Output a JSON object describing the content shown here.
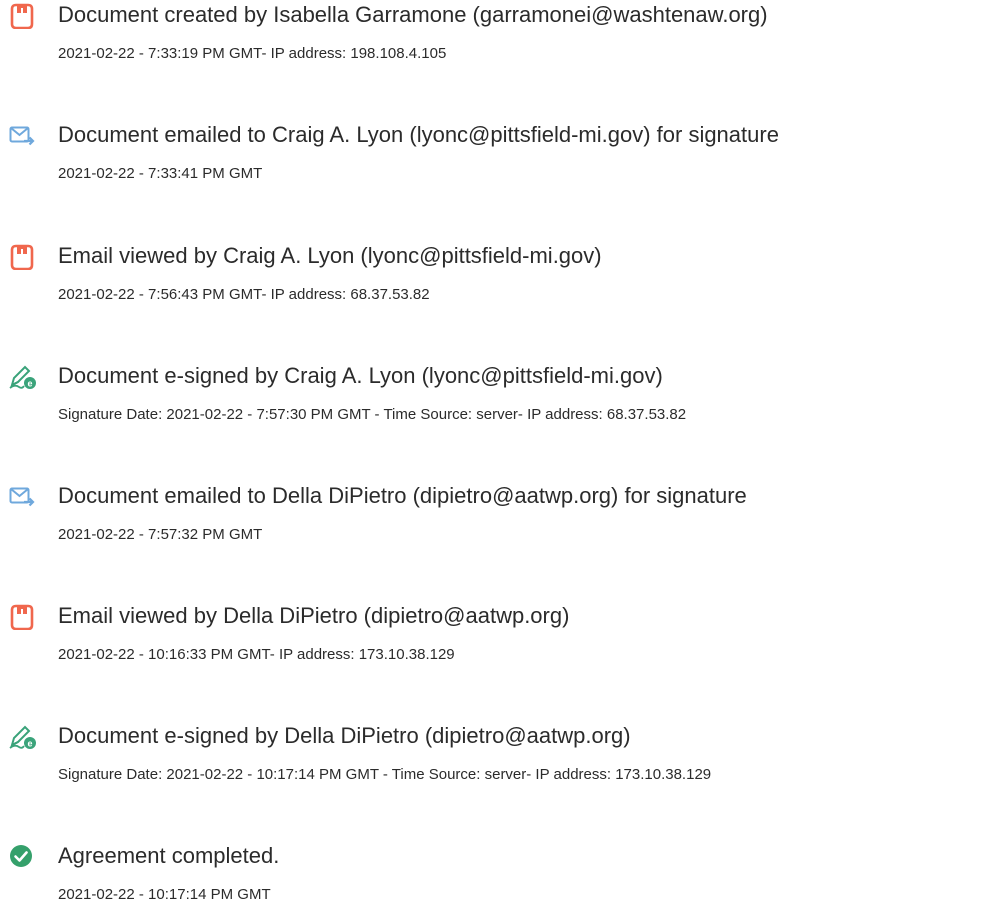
{
  "events": [
    {
      "icon": "document-created-icon",
      "title": "Document created by Isabella Garramone (garramonei@washtenaw.org)",
      "detail": "2021-02-22 - 7:33:19 PM GMT- IP address: 198.108.4.105"
    },
    {
      "icon": "email-sent-icon",
      "title": "Document emailed to Craig A. Lyon (lyonc@pittsfield-mi.gov) for signature",
      "detail": "2021-02-22 - 7:33:41 PM GMT"
    },
    {
      "icon": "document-viewed-icon",
      "title": "Email viewed by Craig A. Lyon (lyonc@pittsfield-mi.gov)",
      "detail": "2021-02-22 - 7:56:43 PM GMT- IP address: 68.37.53.82"
    },
    {
      "icon": "e-signed-icon",
      "title": "Document e-signed by Craig A. Lyon (lyonc@pittsfield-mi.gov)",
      "detail": "Signature Date: 2021-02-22 - 7:57:30 PM GMT - Time Source: server- IP address: 68.37.53.82"
    },
    {
      "icon": "email-sent-icon",
      "title": "Document emailed to Della DiPietro (dipietro@aatwp.org) for signature",
      "detail": "2021-02-22 - 7:57:32 PM GMT"
    },
    {
      "icon": "document-viewed-icon",
      "title": "Email viewed by Della DiPietro (dipietro@aatwp.org)",
      "detail": "2021-02-22 - 10:16:33 PM GMT- IP address: 173.10.38.129"
    },
    {
      "icon": "e-signed-icon",
      "title": "Document e-signed by Della DiPietro (dipietro@aatwp.org)",
      "detail": "Signature Date: 2021-02-22 - 10:17:14 PM GMT - Time Source: server- IP address: 173.10.38.129"
    },
    {
      "icon": "completed-check-icon",
      "title": "Agreement completed.",
      "detail": "2021-02-22 - 10:17:14 PM GMT"
    }
  ],
  "colors": {
    "text": "#2b2b2b",
    "document_icon": "#f0674d",
    "email_icon": "#6fa8dc",
    "esign_green": "#3aa37a",
    "check_green": "#35a06b"
  }
}
